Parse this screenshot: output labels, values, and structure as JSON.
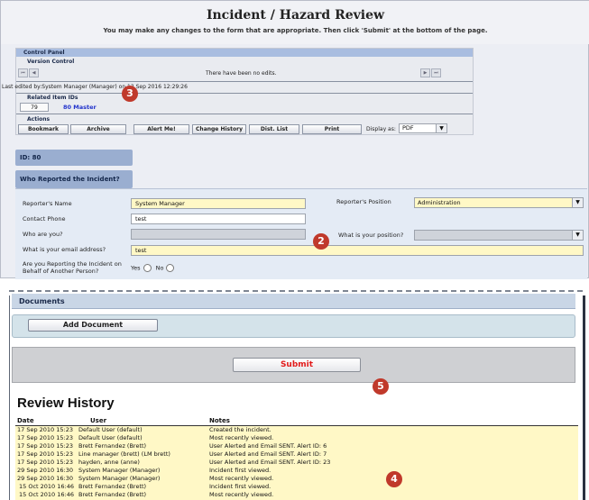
{
  "header": {
    "title": "Incident / Hazard Review",
    "subtitle": "You may make any changes to the form that are appropriate. Then click 'Submit' at the bottom of the page."
  },
  "control_panel": {
    "heading": "Control Panel",
    "version_control_label": "Version Control",
    "edits_message": "There have been no edits.",
    "last_edited": "Last edited by:System Manager (Manager) on 12 Sep 2016 12:29:26",
    "related_label": "Related Item IDs",
    "related_id": "79",
    "related_link": "80 Master",
    "actions_label": "Actions",
    "actions": [
      "Bookmark",
      "Archive",
      "Alert Me!",
      "Change History",
      "Dist. List",
      "Print"
    ],
    "display_as_label": "Display as:",
    "display_as_value": "PDF"
  },
  "id_band": "ID: 80",
  "section_band": "Who Reported the Incident?",
  "form": {
    "reporter_name_label": "Reporter's Name",
    "reporter_name_value": "System Manager",
    "reporter_position_label": "Reporter's Position",
    "reporter_position_value": "Administration",
    "contact_phone_label": "Contact Phone",
    "contact_phone_value": "test",
    "who_are_you_label": "Who are you?",
    "what_position_label": "What is your position?",
    "email_label": "What is your email address?",
    "email_value": "test",
    "behalf_label": "Are you Reporting the Incident on Behalf of Another Person?",
    "yes_label": "Yes",
    "no_label": "No"
  },
  "markers": {
    "m3": "3",
    "m2": "2",
    "m5": "5",
    "m4": "4"
  },
  "documents": {
    "heading": "Documents",
    "add_button": "Add Document"
  },
  "submit_label": "Submit",
  "review_history": {
    "title": "Review History",
    "columns": {
      "date": "Date",
      "user": "User",
      "notes": "Notes"
    },
    "rows": [
      {
        "date": "17 Sep 2010 15:23",
        "user": "Default User (default)",
        "notes": "Created the incident."
      },
      {
        "date": "17 Sep 2010 15:23",
        "user": "Default User (default)",
        "notes": "Most recently viewed."
      },
      {
        "date": "17 Sep 2010 15:23",
        "user": "Brett Fernandez (Brett)",
        "notes": "User Alerted and Email SENT. Alert ID: 6"
      },
      {
        "date": "17 Sep 2010 15:23",
        "user": "Line manager (brett) (LM brett)",
        "notes": "User Alerted and Email SENT. Alert ID: 7"
      },
      {
        "date": "17 Sep 2010 15:23",
        "user": "hayden, anne (anne)",
        "notes": "User Alerted and Email SENT. Alert ID: 23"
      },
      {
        "date": "29 Sep 2010 16:30",
        "user": "System Manager (Manager)",
        "notes": "Incident first viewed."
      },
      {
        "date": "29 Sep 2010 16:30",
        "user": "System Manager (Manager)",
        "notes": "Most recently viewed."
      },
      {
        "date": "15 Oct 2010 16:46",
        "user": "Brett Fernandez (Brett)",
        "notes": "Incident first viewed."
      },
      {
        "date": "15 Oct 2010 16:46",
        "user": "Brett Fernandez (Brett)",
        "notes": "Most recently viewed."
      }
    ]
  },
  "colors": {
    "marker": "#c0392b",
    "submit_text": "#e21b1b",
    "field_highlight": "#fff8c6",
    "section_band": "#9aaed0"
  }
}
